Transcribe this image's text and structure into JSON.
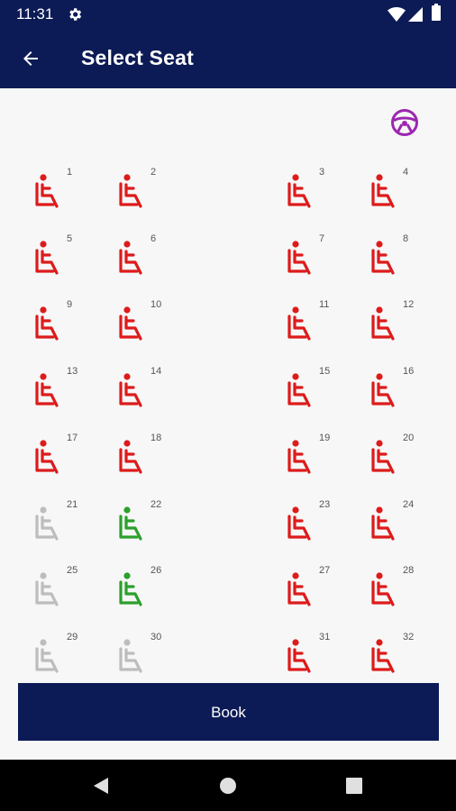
{
  "status_bar": {
    "time": "11:31",
    "icons": [
      "gear-icon",
      "wifi-icon",
      "signal-icon",
      "battery-icon"
    ]
  },
  "app_bar": {
    "title": "Select Seat",
    "back_icon": "arrow-back-icon"
  },
  "driver_icon": "steering-wheel-icon",
  "colors": {
    "booked": "#dd1b1b",
    "available": "#bdbdbd",
    "selected": "#2ca02c",
    "primary": "#0c1b56",
    "steering": "#9c27b0"
  },
  "seats": [
    {
      "number": "1",
      "status": "booked"
    },
    {
      "number": "2",
      "status": "booked"
    },
    {
      "number": "3",
      "status": "booked"
    },
    {
      "number": "4",
      "status": "booked"
    },
    {
      "number": "5",
      "status": "booked"
    },
    {
      "number": "6",
      "status": "booked"
    },
    {
      "number": "7",
      "status": "booked"
    },
    {
      "number": "8",
      "status": "booked"
    },
    {
      "number": "9",
      "status": "booked"
    },
    {
      "number": "10",
      "status": "booked"
    },
    {
      "number": "11",
      "status": "booked"
    },
    {
      "number": "12",
      "status": "booked"
    },
    {
      "number": "13",
      "status": "booked"
    },
    {
      "number": "14",
      "status": "booked"
    },
    {
      "number": "15",
      "status": "booked"
    },
    {
      "number": "16",
      "status": "booked"
    },
    {
      "number": "17",
      "status": "booked"
    },
    {
      "number": "18",
      "status": "booked"
    },
    {
      "number": "19",
      "status": "booked"
    },
    {
      "number": "20",
      "status": "booked"
    },
    {
      "number": "21",
      "status": "available"
    },
    {
      "number": "22",
      "status": "selected"
    },
    {
      "number": "23",
      "status": "booked"
    },
    {
      "number": "24",
      "status": "booked"
    },
    {
      "number": "25",
      "status": "available"
    },
    {
      "number": "26",
      "status": "selected"
    },
    {
      "number": "27",
      "status": "booked"
    },
    {
      "number": "28",
      "status": "booked"
    },
    {
      "number": "29",
      "status": "available"
    },
    {
      "number": "30",
      "status": "available"
    },
    {
      "number": "31",
      "status": "booked"
    },
    {
      "number": "32",
      "status": "booked"
    }
  ],
  "book_button": {
    "label": "Book"
  },
  "nav_bar": {
    "buttons": [
      "back-triangle-icon",
      "home-circle-icon",
      "recents-square-icon"
    ]
  }
}
